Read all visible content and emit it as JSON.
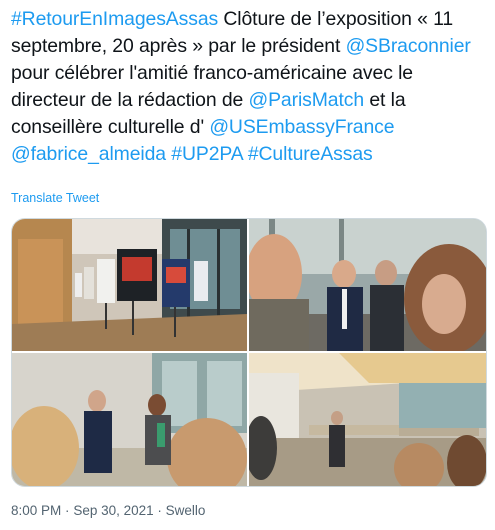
{
  "tweet": {
    "segments": [
      {
        "text": "#RetourEnImagesAssas",
        "link": true
      },
      {
        "text": " Clôture de l’exposition « 11 septembre, 20 après » par le président ",
        "link": false
      },
      {
        "text": "@SBraconnier",
        "link": true
      },
      {
        "text": " pour célébrer l'amitié franco-américaine avec le directeur de la rédaction de ",
        "link": false
      },
      {
        "text": "@ParisMatch",
        "link": true
      },
      {
        "text": " et la conseillère culturelle d' ",
        "link": false
      },
      {
        "text": "@USEmbassyFrance",
        "link": true
      },
      {
        "text": " ",
        "link": false
      },
      {
        "text": "@fabrice_almeida",
        "link": true
      },
      {
        "text": " ",
        "link": false
      },
      {
        "text": "#UP2PA",
        "link": true
      },
      {
        "text": " ",
        "link": false
      },
      {
        "text": "#CultureAssas",
        "link": true
      }
    ],
    "translate_label": "Translate Tweet",
    "time": "8:00 PM",
    "separator": "·",
    "date": "Sep 30, 2021",
    "source": "Swello"
  },
  "media": {
    "photos": [
      {
        "name": "exhibition-panels-photo"
      },
      {
        "name": "speakers-microphone-photo"
      },
      {
        "name": "audience-speakers-photo"
      },
      {
        "name": "library-hall-photo"
      }
    ]
  },
  "colors": {
    "link": "#1d9bf0",
    "text": "#0f1419",
    "meta": "#536471",
    "border": "#cfd9de"
  }
}
